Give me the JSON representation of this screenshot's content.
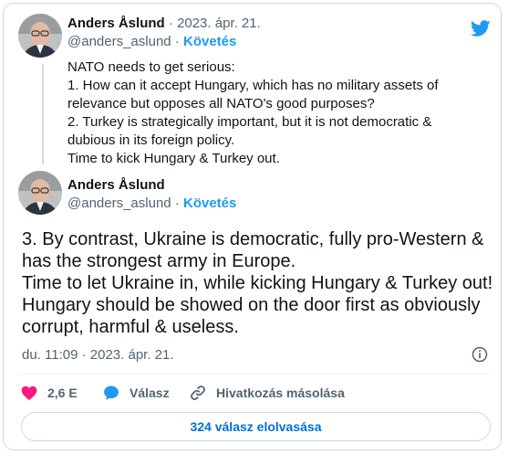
{
  "quoted_tweet": {
    "author_name": "Anders Åslund",
    "date": "· 2023. ápr. 21.",
    "handle": "@anders_aslund",
    "separator": "·",
    "follow_label": "Követés",
    "lines": [
      "NATO needs to get serious:",
      "1. How can it accept Hungary, which has no military assets of",
      "relevance but opposes all NATO's good purposes?",
      "2. Turkey is strategically important, but it is not democratic &",
      "dubious in its foreign policy.",
      "Time to kick Hungary & Turkey out."
    ]
  },
  "main_tweet": {
    "author_name": "Anders Åslund",
    "handle": "@anders_aslund",
    "separator": "·",
    "follow_label": "Követés",
    "lines": [
      "3. By contrast, Ukraine is democratic, fully pro-Western &",
      "has the strongest army in Europe.",
      "Time to let Ukraine in, while kicking Hungary & Turkey out!",
      "Hungary should be showed on the door first as obviously",
      "corrupt, harmful & useless."
    ],
    "timestamp": "du. 11:09 · 2023. ápr. 21."
  },
  "actions": {
    "like_count": "2,6 E",
    "reply_label": "Válasz",
    "copy_link_label": "Hivatkozás másolása"
  },
  "read_replies_label": "324 válasz elolvasása",
  "colors": {
    "brand_blue": "#1d9bf0",
    "like_red": "#f91880",
    "text": "#0f1419",
    "muted": "#536471",
    "border": "#cfd9de"
  },
  "icons": [
    "twitter-bird-icon",
    "heart-icon",
    "reply-bubble-icon",
    "link-icon",
    "info-icon"
  ]
}
